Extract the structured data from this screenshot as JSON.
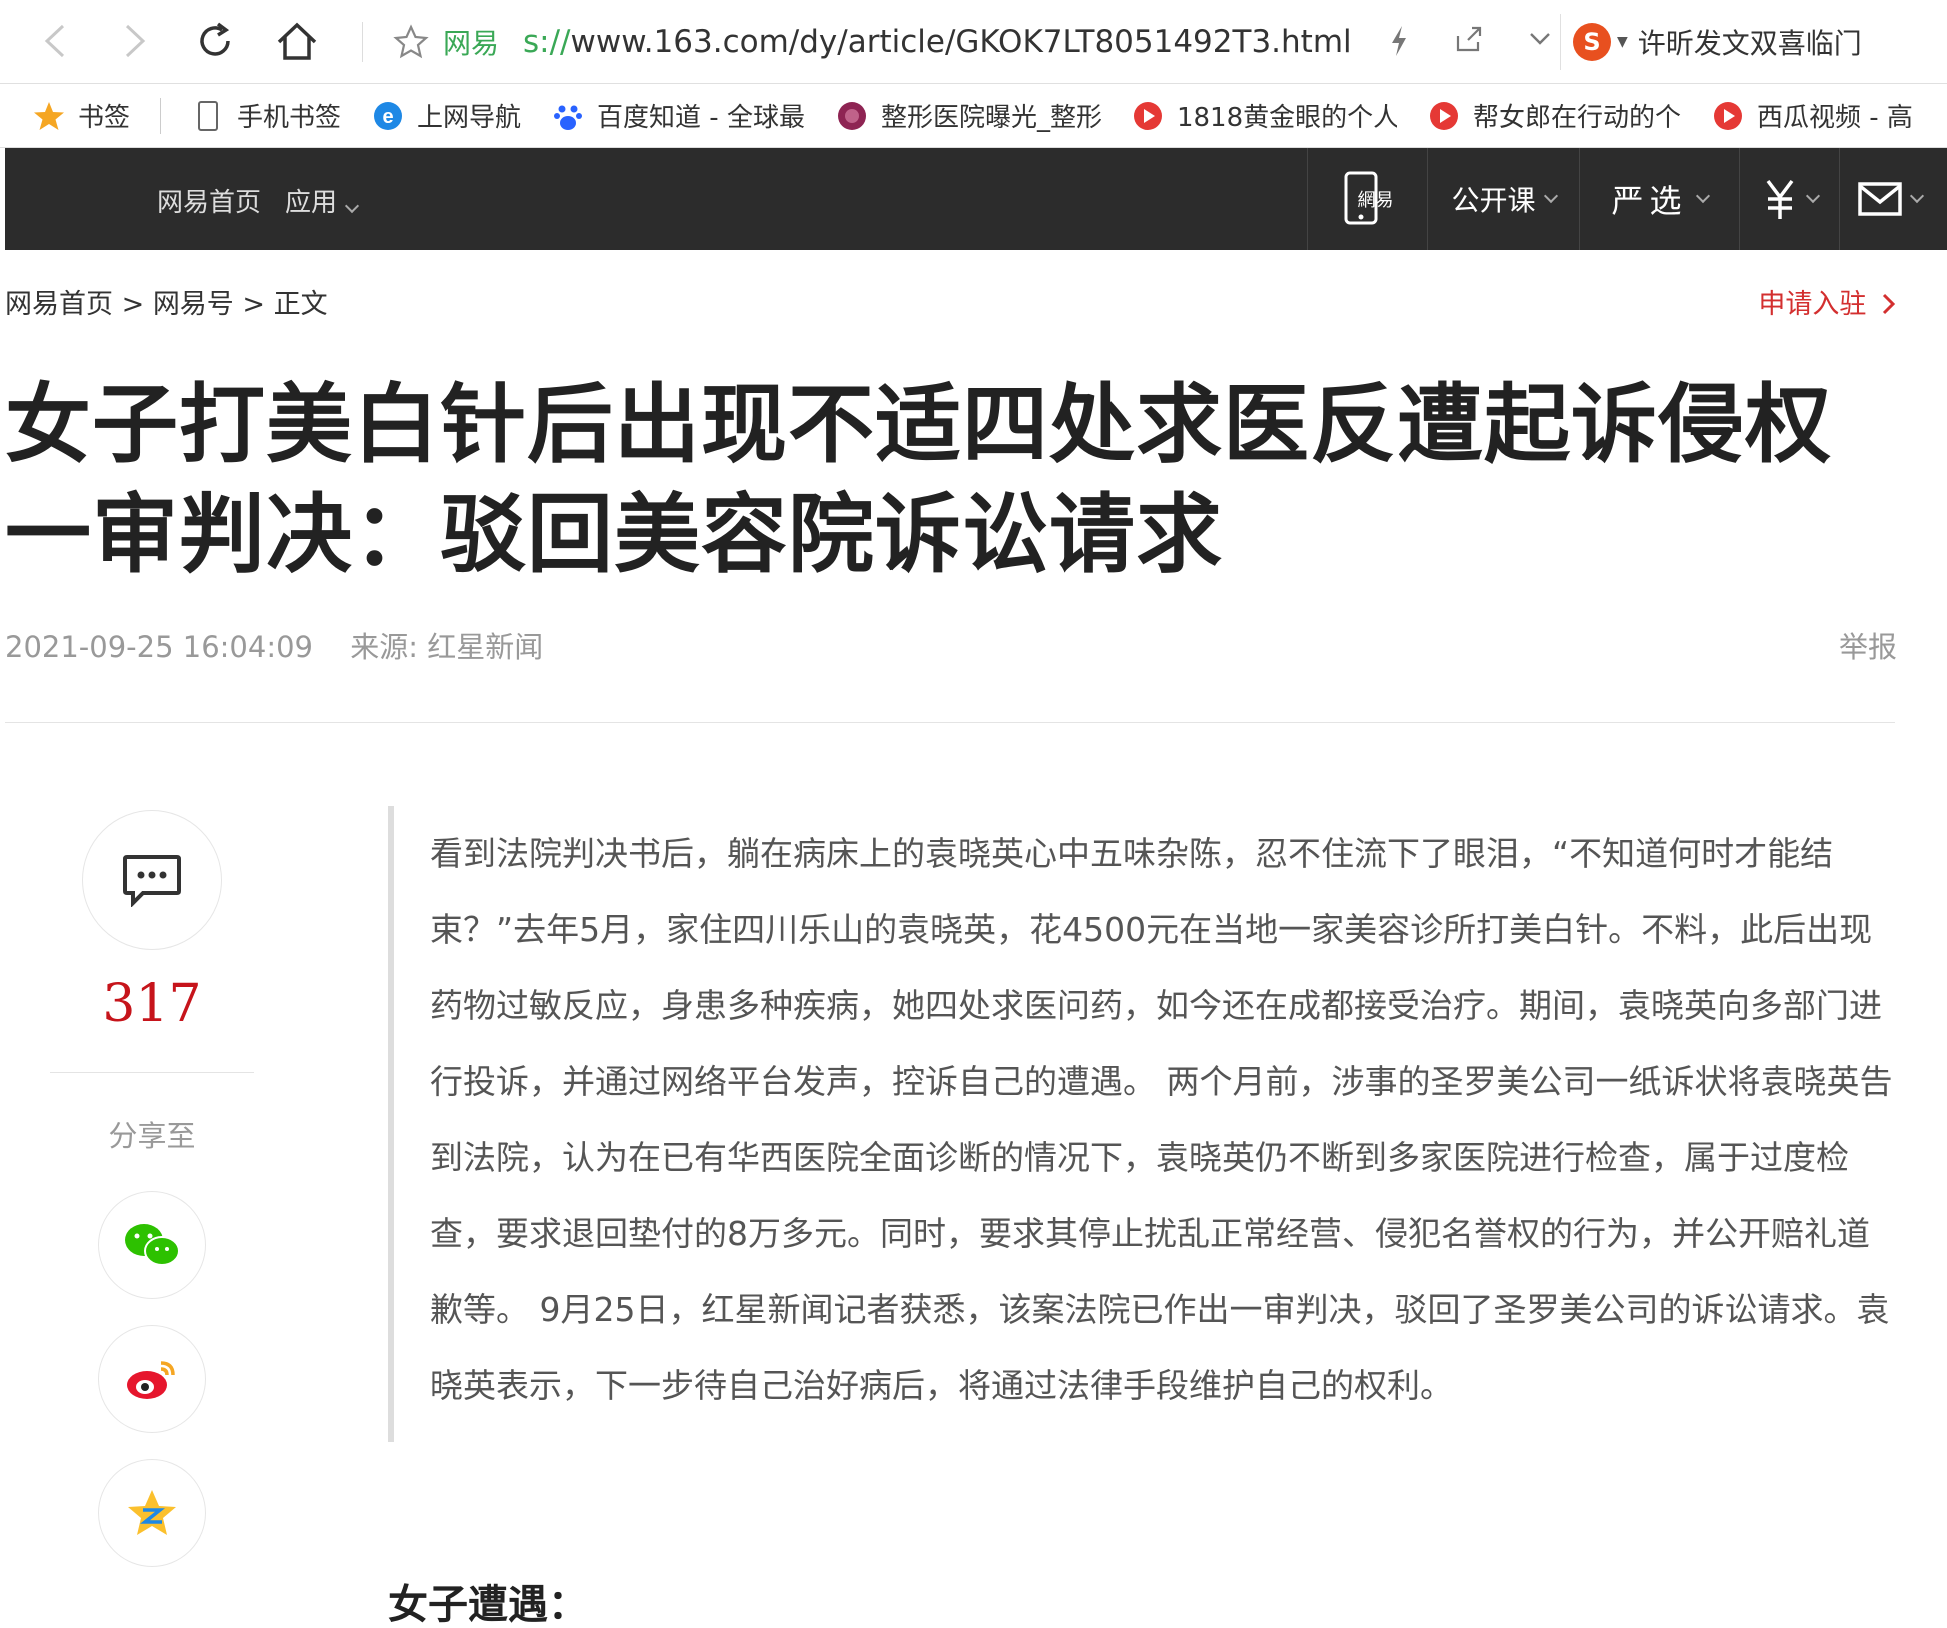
{
  "browser": {
    "site_label": "网易",
    "url_proto": "s://",
    "url_rest": "www.163.com/dy/article/GKOK7LT8051492T3.html",
    "search_text": "许昕发文双喜临门"
  },
  "bookmarks": [
    {
      "label": "书签",
      "icon": "star-icon"
    },
    {
      "label": "手机书签",
      "icon": "phone-icon"
    },
    {
      "label": "上网导航",
      "icon": "ie-icon"
    },
    {
      "label": "百度知道 - 全球最",
      "icon": "baidu-icon"
    },
    {
      "label": "整形医院曝光_整形",
      "icon": "hospital-icon"
    },
    {
      "label": "1818黄金眼的个人",
      "icon": "play-icon"
    },
    {
      "label": "帮女郎在行动的个",
      "icon": "play-icon"
    },
    {
      "label": "西瓜视频 - 高",
      "icon": "play-icon"
    }
  ],
  "site_nav": {
    "home": "网易首页",
    "apps": "应用",
    "mobile_label": "網易",
    "open_course": "公开课",
    "yanxuan": "严选"
  },
  "breadcrumb": {
    "home": "网易首页",
    "sep": ">",
    "section": "网易号",
    "current": "正文"
  },
  "apply_label": "申请入驻",
  "article": {
    "title_line1": "女子打美白针后出现不适四处求医反遭起诉侵权",
    "title_line2": "一审判决：驳回美容院诉讼请求",
    "datetime": "2021-09-25 16:04:09",
    "source": "来源: 红星新闻",
    "report_label": "举报",
    "summary": "看到法院判决书后，躺在病床上的袁晓英心中五味杂陈，忍不住流下了眼泪，“不知道何时才能结束？”去年5月，家住四川乐山的袁晓英，花4500元在当地一家美容诊所打美白针。不料，此后出现药物过敏反应，身患多种疾病，她四处求医问药，如今还在成都接受治疗。期间，袁晓英向多部门进行投诉，并通过网络平台发声，控诉自己的遭遇。 两个月前，涉事的圣罗美公司一纸诉状将袁晓英告到法院，认为在已有华西医院全面诊断的情况下，袁晓英仍不断到多家医院进行检查，属于过度检查，要求退回垫付的8万多元。同时，要求其停止扰乱正常经营、侵犯名誉权的行为，并公开赔礼道歉等。 9月25日，红星新闻记者获悉，该案法院已作出一审判决，驳回了圣罗美公司的诉讼请求。袁晓英表示，下一步待自己治好病后，将通过法律手段维护自己的权利。",
    "subhead": "女子遭遇："
  },
  "share": {
    "comment_count": "317",
    "share_label": "分享至"
  },
  "colors": {
    "nav_bg": "#2c2c2c",
    "accent_red": "#c6141b",
    "link_green": "#3aa856"
  }
}
